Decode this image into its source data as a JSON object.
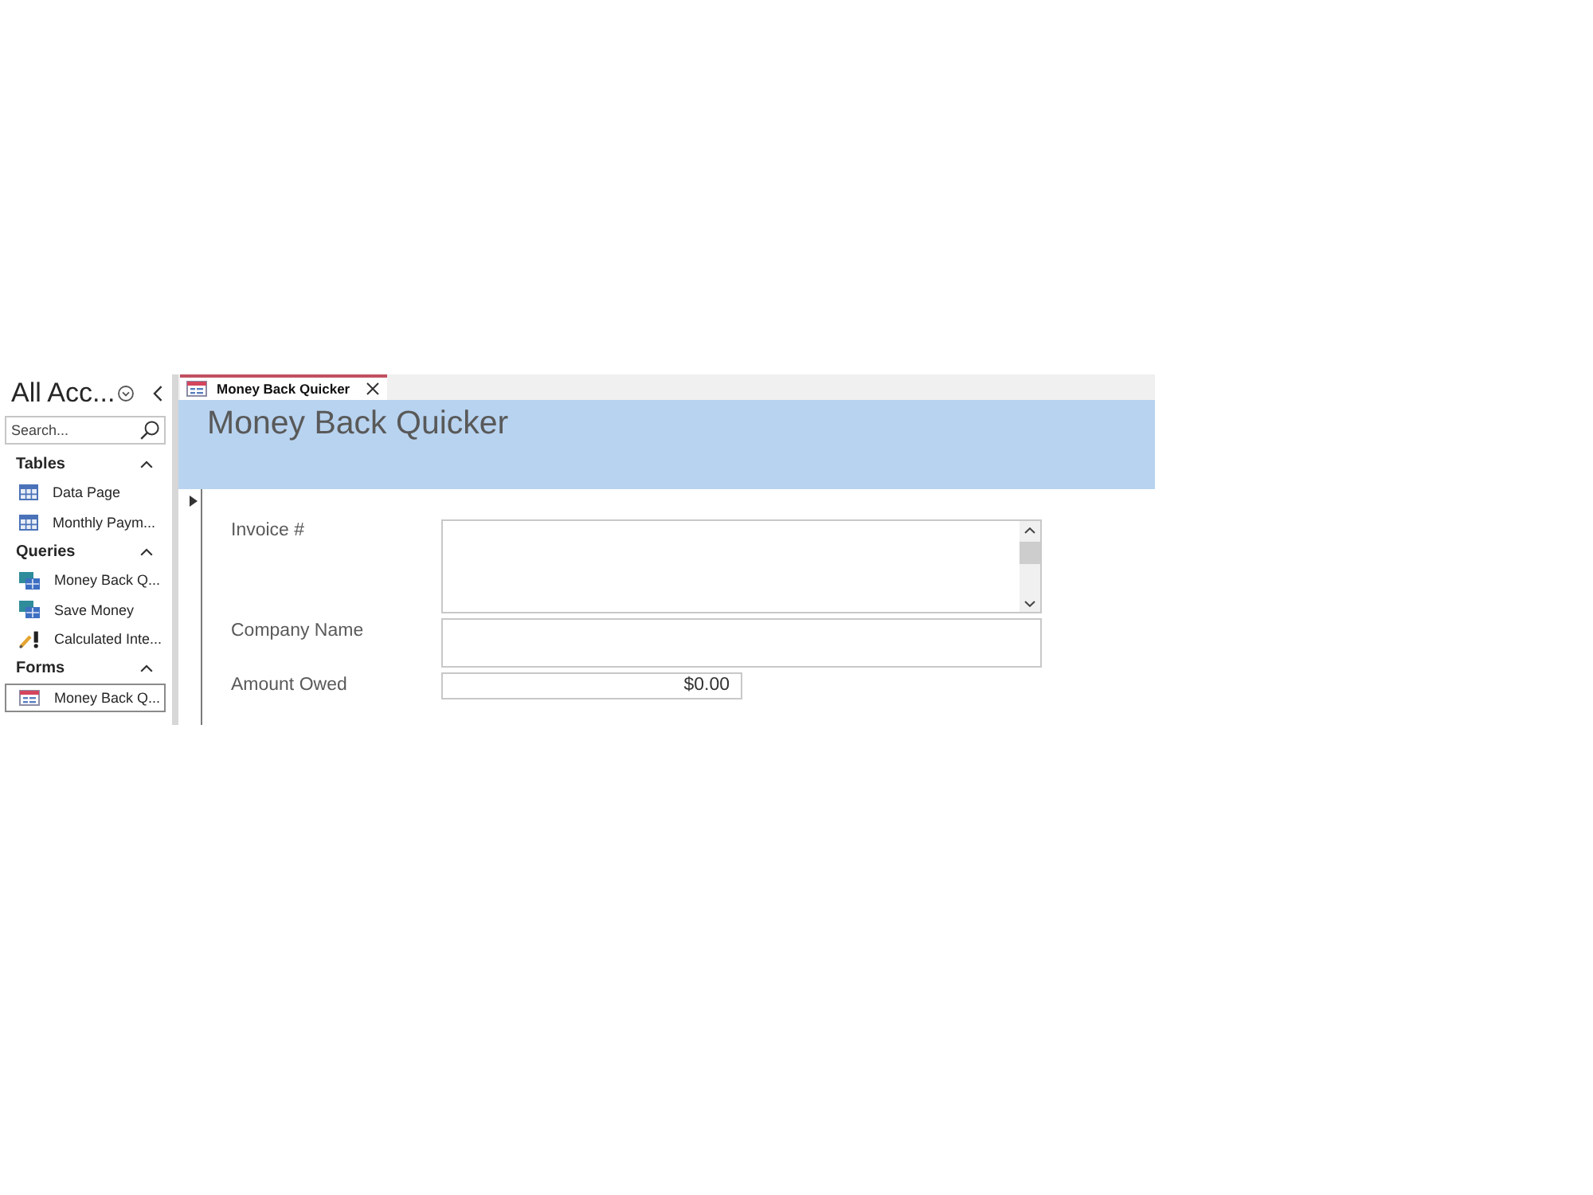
{
  "navigation_pane": {
    "title": "All Acc...",
    "search": {
      "placeholder": "Search..."
    },
    "groups": [
      {
        "label": "Tables",
        "expanded": true,
        "items": [
          {
            "label": "Data Page",
            "kind": "table",
            "selected": false
          },
          {
            "label": "Monthly Paym...",
            "kind": "table",
            "selected": false
          }
        ]
      },
      {
        "label": "Queries",
        "expanded": true,
        "items": [
          {
            "label": "Money Back Q...",
            "kind": "select_query",
            "selected": false
          },
          {
            "label": "Save Money",
            "kind": "select_query",
            "selected": false
          },
          {
            "label": "Calculated Inte...",
            "kind": "update_query",
            "selected": false
          }
        ]
      },
      {
        "label": "Forms",
        "expanded": true,
        "items": [
          {
            "label": "Money Back Q...",
            "kind": "form",
            "selected": true
          }
        ]
      }
    ]
  },
  "tabs": [
    {
      "label": "Money Back Quicker",
      "selected": true
    }
  ],
  "form": {
    "title": "Money Back Quicker",
    "fields": [
      {
        "label": "Invoice #",
        "kind": "memo"
      },
      {
        "label": "Company Name",
        "kind": "text"
      },
      {
        "label": "Amount Owed",
        "kind": "currency",
        "value": "$0.00"
      }
    ]
  }
}
